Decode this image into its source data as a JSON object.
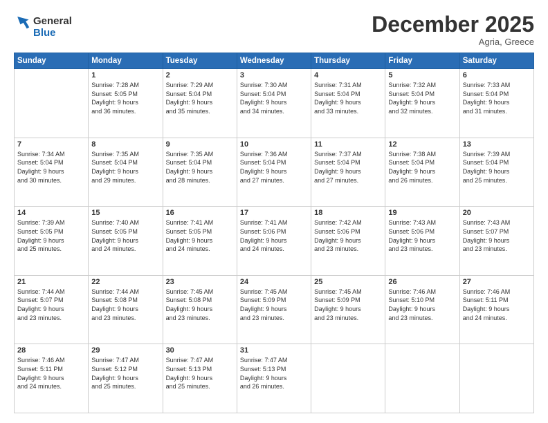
{
  "header": {
    "logo_line1": "General",
    "logo_line2": "Blue",
    "title": "December 2025",
    "location": "Agria, Greece"
  },
  "columns": [
    "Sunday",
    "Monday",
    "Tuesday",
    "Wednesday",
    "Thursday",
    "Friday",
    "Saturday"
  ],
  "weeks": [
    [
      {
        "day": "",
        "info": ""
      },
      {
        "day": "1",
        "info": "Sunrise: 7:28 AM\nSunset: 5:05 PM\nDaylight: 9 hours\nand 36 minutes."
      },
      {
        "day": "2",
        "info": "Sunrise: 7:29 AM\nSunset: 5:04 PM\nDaylight: 9 hours\nand 35 minutes."
      },
      {
        "day": "3",
        "info": "Sunrise: 7:30 AM\nSunset: 5:04 PM\nDaylight: 9 hours\nand 34 minutes."
      },
      {
        "day": "4",
        "info": "Sunrise: 7:31 AM\nSunset: 5:04 PM\nDaylight: 9 hours\nand 33 minutes."
      },
      {
        "day": "5",
        "info": "Sunrise: 7:32 AM\nSunset: 5:04 PM\nDaylight: 9 hours\nand 32 minutes."
      },
      {
        "day": "6",
        "info": "Sunrise: 7:33 AM\nSunset: 5:04 PM\nDaylight: 9 hours\nand 31 minutes."
      }
    ],
    [
      {
        "day": "7",
        "info": "Sunrise: 7:34 AM\nSunset: 5:04 PM\nDaylight: 9 hours\nand 30 minutes."
      },
      {
        "day": "8",
        "info": "Sunrise: 7:35 AM\nSunset: 5:04 PM\nDaylight: 9 hours\nand 29 minutes."
      },
      {
        "day": "9",
        "info": "Sunrise: 7:35 AM\nSunset: 5:04 PM\nDaylight: 9 hours\nand 28 minutes."
      },
      {
        "day": "10",
        "info": "Sunrise: 7:36 AM\nSunset: 5:04 PM\nDaylight: 9 hours\nand 27 minutes."
      },
      {
        "day": "11",
        "info": "Sunrise: 7:37 AM\nSunset: 5:04 PM\nDaylight: 9 hours\nand 27 minutes."
      },
      {
        "day": "12",
        "info": "Sunrise: 7:38 AM\nSunset: 5:04 PM\nDaylight: 9 hours\nand 26 minutes."
      },
      {
        "day": "13",
        "info": "Sunrise: 7:39 AM\nSunset: 5:04 PM\nDaylight: 9 hours\nand 25 minutes."
      }
    ],
    [
      {
        "day": "14",
        "info": "Sunrise: 7:39 AM\nSunset: 5:05 PM\nDaylight: 9 hours\nand 25 minutes."
      },
      {
        "day": "15",
        "info": "Sunrise: 7:40 AM\nSunset: 5:05 PM\nDaylight: 9 hours\nand 24 minutes."
      },
      {
        "day": "16",
        "info": "Sunrise: 7:41 AM\nSunset: 5:05 PM\nDaylight: 9 hours\nand 24 minutes."
      },
      {
        "day": "17",
        "info": "Sunrise: 7:41 AM\nSunset: 5:06 PM\nDaylight: 9 hours\nand 24 minutes."
      },
      {
        "day": "18",
        "info": "Sunrise: 7:42 AM\nSunset: 5:06 PM\nDaylight: 9 hours\nand 23 minutes."
      },
      {
        "day": "19",
        "info": "Sunrise: 7:43 AM\nSunset: 5:06 PM\nDaylight: 9 hours\nand 23 minutes."
      },
      {
        "day": "20",
        "info": "Sunrise: 7:43 AM\nSunset: 5:07 PM\nDaylight: 9 hours\nand 23 minutes."
      }
    ],
    [
      {
        "day": "21",
        "info": "Sunrise: 7:44 AM\nSunset: 5:07 PM\nDaylight: 9 hours\nand 23 minutes."
      },
      {
        "day": "22",
        "info": "Sunrise: 7:44 AM\nSunset: 5:08 PM\nDaylight: 9 hours\nand 23 minutes."
      },
      {
        "day": "23",
        "info": "Sunrise: 7:45 AM\nSunset: 5:08 PM\nDaylight: 9 hours\nand 23 minutes."
      },
      {
        "day": "24",
        "info": "Sunrise: 7:45 AM\nSunset: 5:09 PM\nDaylight: 9 hours\nand 23 minutes."
      },
      {
        "day": "25",
        "info": "Sunrise: 7:45 AM\nSunset: 5:09 PM\nDaylight: 9 hours\nand 23 minutes."
      },
      {
        "day": "26",
        "info": "Sunrise: 7:46 AM\nSunset: 5:10 PM\nDaylight: 9 hours\nand 23 minutes."
      },
      {
        "day": "27",
        "info": "Sunrise: 7:46 AM\nSunset: 5:11 PM\nDaylight: 9 hours\nand 24 minutes."
      }
    ],
    [
      {
        "day": "28",
        "info": "Sunrise: 7:46 AM\nSunset: 5:11 PM\nDaylight: 9 hours\nand 24 minutes."
      },
      {
        "day": "29",
        "info": "Sunrise: 7:47 AM\nSunset: 5:12 PM\nDaylight: 9 hours\nand 25 minutes."
      },
      {
        "day": "30",
        "info": "Sunrise: 7:47 AM\nSunset: 5:13 PM\nDaylight: 9 hours\nand 25 minutes."
      },
      {
        "day": "31",
        "info": "Sunrise: 7:47 AM\nSunset: 5:13 PM\nDaylight: 9 hours\nand 26 minutes."
      },
      {
        "day": "",
        "info": ""
      },
      {
        "day": "",
        "info": ""
      },
      {
        "day": "",
        "info": ""
      }
    ]
  ]
}
